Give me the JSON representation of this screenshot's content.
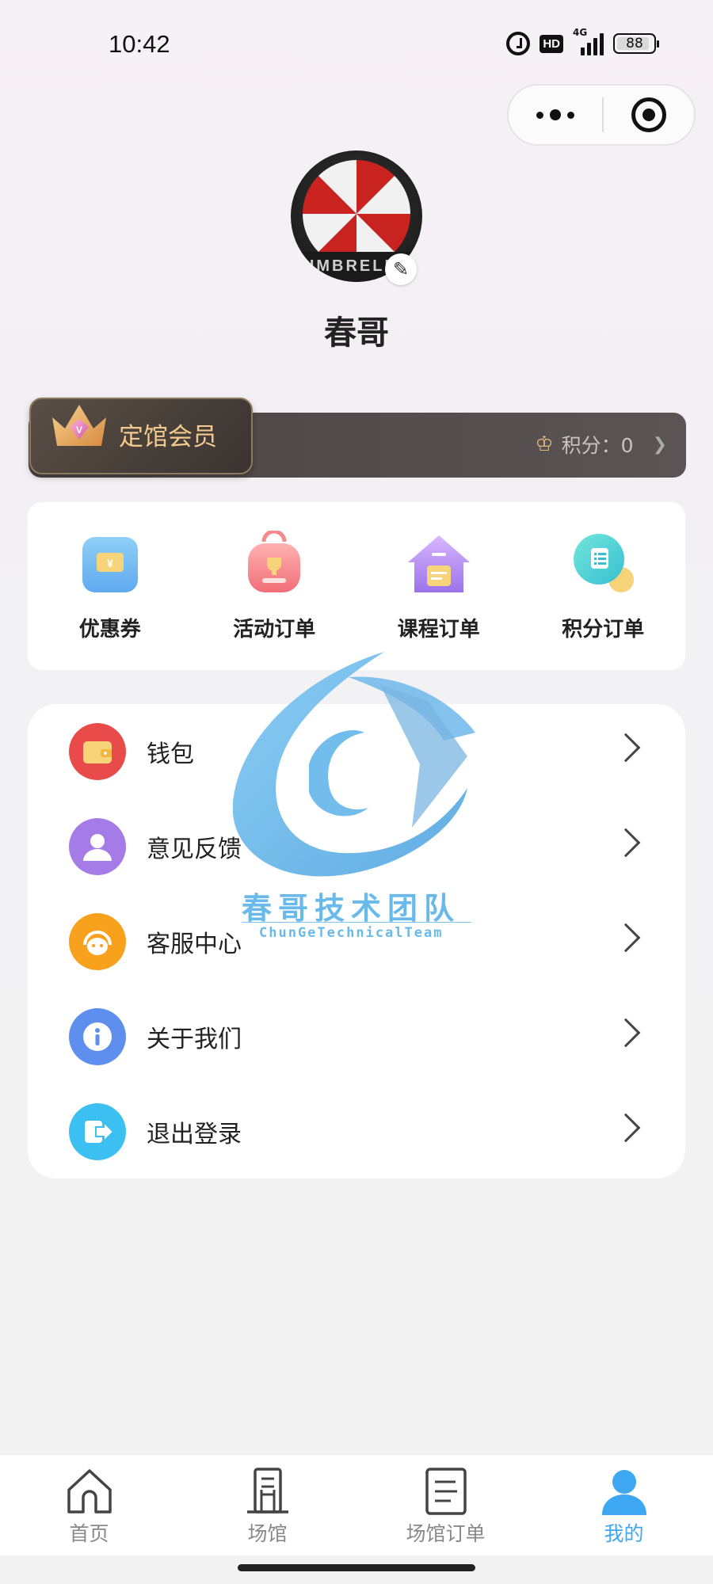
{
  "status_bar": {
    "time": "10:42",
    "hd": "HD",
    "network": "4G",
    "battery": "88"
  },
  "profile": {
    "name": "春哥",
    "avatar_text": "UMBRELLA"
  },
  "member": {
    "label": "定馆会员",
    "points_label": "积分：0"
  },
  "quick_actions": [
    {
      "label": "优惠券",
      "icon": "coupon-icon"
    },
    {
      "label": "活动订单",
      "icon": "trophy-bag-icon"
    },
    {
      "label": "课程订单",
      "icon": "course-house-icon"
    },
    {
      "label": "积分订单",
      "icon": "points-doc-icon"
    }
  ],
  "menu": [
    {
      "label": "钱包",
      "icon": "wallet-icon",
      "color": "#e94b4b"
    },
    {
      "label": "意见反馈",
      "icon": "user-feedback-icon",
      "color": "#a57be8"
    },
    {
      "label": "客服中心",
      "icon": "headset-icon",
      "color": "#f7a11d"
    },
    {
      "label": "关于我们",
      "icon": "info-icon",
      "color": "#5f8fee"
    },
    {
      "label": "退出登录",
      "icon": "logout-icon",
      "color": "#3cc0f2"
    }
  ],
  "watermark": {
    "title": "春哥技术团队",
    "subtitle": "ChunGeTechnicalTeam"
  },
  "tab_bar": [
    {
      "label": "首页",
      "icon": "home-icon",
      "active": false
    },
    {
      "label": "场馆",
      "icon": "building-icon",
      "active": false
    },
    {
      "label": "场馆订单",
      "icon": "order-doc-icon",
      "active": false
    },
    {
      "label": "我的",
      "icon": "user-icon",
      "active": true
    }
  ],
  "colors": {
    "accent": "#3ea7f2",
    "member_gold": "#f2c98e",
    "member_bg": "#4b4444"
  }
}
